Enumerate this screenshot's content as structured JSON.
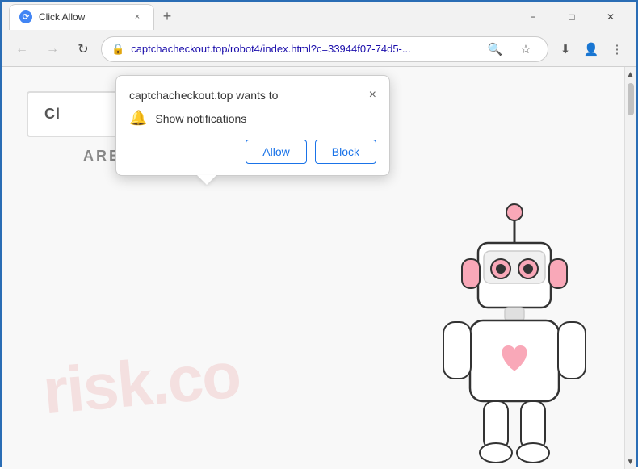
{
  "titlebar": {
    "tab_label": "Click Allow",
    "close_tab_label": "×",
    "new_tab_label": "+",
    "minimize_label": "−",
    "maximize_label": "□",
    "close_label": "✕"
  },
  "toolbar": {
    "back_label": "←",
    "forward_label": "→",
    "refresh_label": "↻",
    "url": "captchacheckout.top/robot4/index.html?c=33944f07-74d5-...",
    "search_label": "🔍",
    "bookmark_label": "☆",
    "profile_label": "👤",
    "menu_label": "⋮",
    "download_label": "⬇"
  },
  "popup": {
    "title": "captchacheckout.top wants to",
    "close_label": "×",
    "notification_text": "Show notifications",
    "allow_label": "Allow",
    "block_label": "Block"
  },
  "page": {
    "captcha_title": "Cl",
    "captcha_subtitle": "ARE NOT A ROBOT.",
    "watermark": "risk.co"
  },
  "scrollbar": {
    "up_label": "▲",
    "down_label": "▼"
  }
}
